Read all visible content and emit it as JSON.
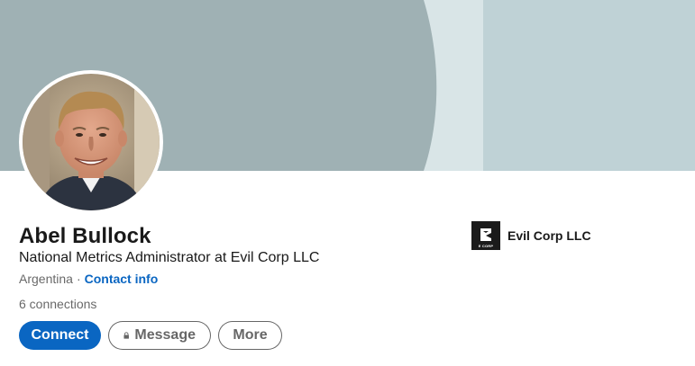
{
  "profile": {
    "name": "Abel Bullock",
    "headline": "National Metrics Administrator at Evil Corp LLC",
    "location": "Argentina",
    "separator": "·",
    "contact_info_label": "Contact info",
    "connections": "6 connections"
  },
  "actions": {
    "connect_label": "Connect",
    "message_label": "Message",
    "more_label": "More"
  },
  "company": {
    "name": "Evil Corp LLC",
    "logo_text": "E CORP",
    "logo_icon": "evil-corp-logo"
  },
  "colors": {
    "accent": "#0a66c2",
    "banner_dark": "#9fb1b4",
    "banner_light": "#bfd2d6",
    "banner_pale": "#d9e5e7"
  }
}
